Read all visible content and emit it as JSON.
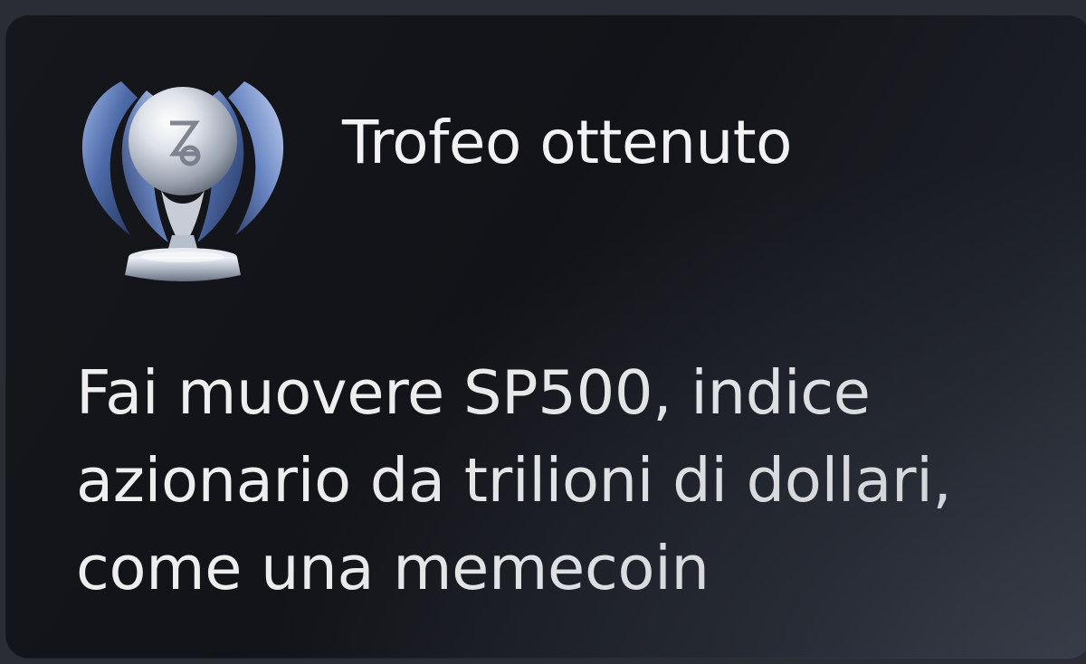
{
  "notification": {
    "title": "Trofeo ottenuto",
    "description": "Fai muovere SP500, indice azionario da trilioni di dollari, come una memecoin",
    "trophy_icon": "platinum-trophy-icon",
    "colors": {
      "card_background": "#14161b",
      "text": "#f2f2f4",
      "trophy_blue": "#5a7bb8",
      "trophy_silver": "#d4d8e0"
    }
  }
}
